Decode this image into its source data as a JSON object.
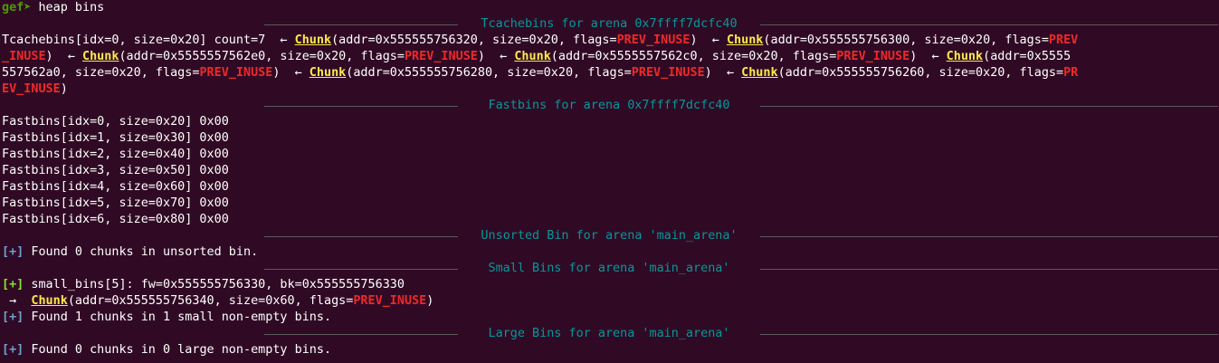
{
  "prompt": {
    "name": "gef",
    "arrow": "➤",
    "command": " heap bins"
  },
  "tcache": {
    "header": "Tcachebins for arena 0x7ffff7dcfc40",
    "lines": [
      [
        {
          "t": "Tcachebins[idx=0, size=0x20] count=7  ← ",
          "c": ""
        },
        {
          "t": "Chunk",
          "c": "chunk"
        },
        {
          "t": "(addr=0x555555756320, size=0x20, flags=",
          "c": ""
        },
        {
          "t": "PREV_INUSE",
          "c": "flag"
        },
        {
          "t": ")  ← ",
          "c": ""
        },
        {
          "t": "Chunk",
          "c": "chunk"
        },
        {
          "t": "(addr=0x555555756300, size=0x20, flags=",
          "c": ""
        },
        {
          "t": "PREV",
          "c": "flag"
        }
      ],
      [
        {
          "t": "_INUSE",
          "c": "flag"
        },
        {
          "t": ")  ← ",
          "c": ""
        },
        {
          "t": "Chunk",
          "c": "chunk"
        },
        {
          "t": "(addr=0x5555557562e0, size=0x20, flags=",
          "c": ""
        },
        {
          "t": "PREV_INUSE",
          "c": "flag"
        },
        {
          "t": ")  ← ",
          "c": ""
        },
        {
          "t": "Chunk",
          "c": "chunk"
        },
        {
          "t": "(addr=0x5555557562c0, size=0x20, flags=",
          "c": ""
        },
        {
          "t": "PREV_INUSE",
          "c": "flag"
        },
        {
          "t": ")  ← ",
          "c": ""
        },
        {
          "t": "Chunk",
          "c": "chunk"
        },
        {
          "t": "(addr=0x5555",
          "c": ""
        }
      ],
      [
        {
          "t": "557562a0, size=0x20, flags=",
          "c": ""
        },
        {
          "t": "PREV_INUSE",
          "c": "flag"
        },
        {
          "t": ")  ← ",
          "c": ""
        },
        {
          "t": "Chunk",
          "c": "chunk"
        },
        {
          "t": "(addr=0x555555756280, size=0x20, flags=",
          "c": ""
        },
        {
          "t": "PREV_INUSE",
          "c": "flag"
        },
        {
          "t": ")  ← ",
          "c": ""
        },
        {
          "t": "Chunk",
          "c": "chunk"
        },
        {
          "t": "(addr=0x555555756260, size=0x20, flags=",
          "c": ""
        },
        {
          "t": "PR",
          "c": "flag"
        }
      ],
      [
        {
          "t": "EV_INUSE",
          "c": "flag"
        },
        {
          "t": ")",
          "c": ""
        }
      ]
    ]
  },
  "fastbins": {
    "header": "Fastbins for arena 0x7ffff7dcfc40",
    "lines": [
      "Fastbins[idx=0, size=0x20] 0x00",
      "Fastbins[idx=1, size=0x30] 0x00",
      "Fastbins[idx=2, size=0x40] 0x00",
      "Fastbins[idx=3, size=0x50] 0x00",
      "Fastbins[idx=4, size=0x60] 0x00",
      "Fastbins[idx=5, size=0x70] 0x00",
      "Fastbins[idx=6, size=0x80] 0x00"
    ]
  },
  "unsorted": {
    "header": "Unsorted Bin for arena 'main_arena'",
    "tag": "[+]",
    "text": " Found 0 chunks in unsorted bin."
  },
  "small": {
    "header": "Small Bins for arena 'main_arena'",
    "tag": "[+]",
    "bin_text": " small_bins[5]: fw=0x555555756330, bk=0x555555756330",
    "chunk_prefix": " →  ",
    "chunk_label": "Chunk",
    "chunk_text": "(addr=0x555555756340, size=0x60, flags=",
    "chunk_flag": "PREV_INUSE",
    "chunk_close": ")",
    "found_tag": "[+]",
    "found_text": " Found 1 chunks in 1 small non-empty bins."
  },
  "large": {
    "header": "Large Bins for arena 'main_arena'",
    "tag": "[+]",
    "text": " Found 0 chunks in 0 large non-empty bins."
  },
  "colors": {
    "background": "#300a24",
    "text": "#ffffff",
    "header": "#06989a",
    "chunk": "#fce94f",
    "flag": "#ef2929",
    "prompt": "#4e9a06",
    "tag_found": "#729fcf",
    "tag_green": "#8ae234"
  }
}
